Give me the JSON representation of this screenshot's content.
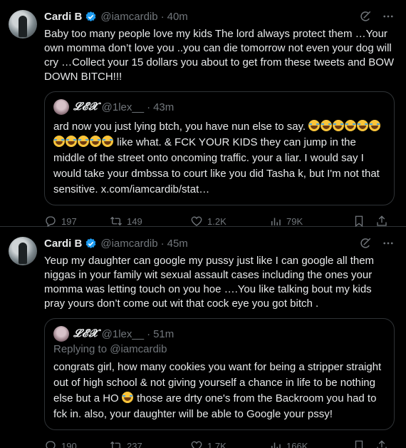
{
  "tweets": [
    {
      "name": "Cardi B",
      "handle": "@iamcardib",
      "sep": "·",
      "time": "40m",
      "text": "Baby too many people love my kids The lord always protect them …Your own momma don’t love you ..you can die tomorrow not even your dog will cry …Collect your 15 dollars you about to get from these tweets and BOW DOWN BITCH!!!",
      "quote": {
        "name": "𝓛𝓔𝓧",
        "handle": "@1lex__",
        "sep": "·",
        "time": "43m",
        "text_a": "ard now you just lying btch, you have nun else to say.",
        "text_b": "like what. & FCK YOUR KIDS they can jump in the middle of the street onto oncoming traffic. your a liar. I would say I would take your dmbssa to court like you did Tasha k, but I'm not that sensitive. x.com/iamcardib/stat…"
      },
      "stats": {
        "replies": "197",
        "retweets": "149",
        "likes": "1.2K",
        "views": "79K"
      }
    },
    {
      "name": "Cardi B",
      "handle": "@iamcardib",
      "sep": "·",
      "time": "45m",
      "text": "Yeup my daughter  can google my pussy just like I can google  all them niggas in your family wit  sexual assault cases including the ones your momma was letting touch on you hoe ….You like talking bout my kids pray yours don’t come out wit that cock eye you got bitch .",
      "quote": {
        "name": "𝓛𝓔𝓧",
        "handle": "@1lex__",
        "sep": "·",
        "time": "51m",
        "replying_to": "Replying to @iamcardib",
        "text_a": "congrats girl, how many cookies you want for being a stripper straight out of high school & not giving yourself a chance in life to be nothing else but a HO",
        "text_b": "those are drty one's from the Backroom you had to fck in. also, your daughter will be able to Google your pssy!"
      },
      "stats": {
        "replies": "190",
        "retweets": "237",
        "likes": "1.7K",
        "views": "166K"
      }
    }
  ],
  "colors": {
    "background": "#000000",
    "text": "#e7e9ea",
    "muted": "#71767b",
    "verified": "#1d9bf0",
    "border": "#2f3336"
  },
  "icons": [
    "verified-badge-icon",
    "grok-icon",
    "more-icon",
    "reply-icon",
    "retweet-icon",
    "like-icon",
    "views-icon",
    "bookmark-icon",
    "share-icon",
    "joy-emoji-icon"
  ]
}
